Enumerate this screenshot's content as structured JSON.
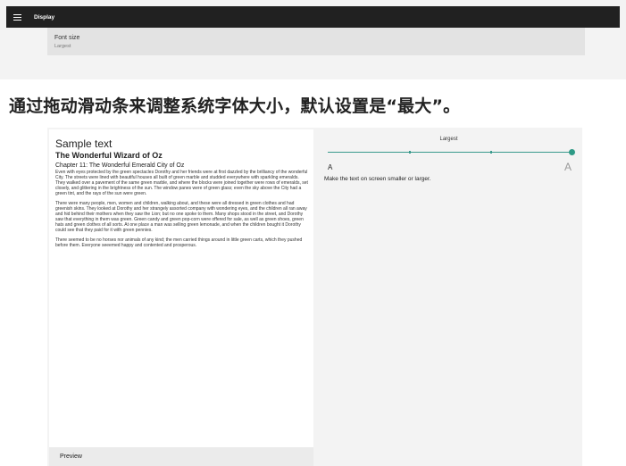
{
  "top": {
    "app_title": "Display",
    "menu_icon": "hamburger-menu-icon",
    "setting": {
      "title": "Font size",
      "value": "Largest"
    }
  },
  "caption": "通过拖动滑动条来调整系统字体大小，默认设置是“最大”。",
  "preview": {
    "heading": "Sample text",
    "book_title": "The Wonderful Wizard of Oz",
    "chapter": "Chapter 11: The Wonderful Emerald City of Oz",
    "paragraphs": [
      "Even with eyes protected by the green spectacles Dorothy and her friends were at first dazzled by the brilliancy of the wonderful City. The streets were lined with beautiful houses all built of green marble and studded everywhere with sparkling emeralds. They walked over a pavement of the same green marble, and where the blocks were joined together were rows of emeralds, set closely, and glittering in the brightness of the sun. The window panes were of green glass; even the sky above the City had a green tint, and the rays of the sun were green.",
      "There were many people, men, women and children, walking about, and these were all dressed in green clothes and had greenish skins. They looked at Dorothy and her strangely assorted company with wondering eyes, and the children all ran away and hid behind their mothers when they saw the Lion; but no one spoke to them. Many shops stood in the street, and Dorothy saw that everything in them was green. Green candy and green pop-corn were offered for sale, as well as green shoes, green hats and green clothes of all sorts. At one place a man was selling green lemonade, and when the children bought it Dorothy could see that they paid for it with green pennies.",
      "There seemed to be no horses nor animals of any kind; the men carried things around in little green carts, which they pushed before them. Everyone seeemed happy and contented and prosperous."
    ],
    "footer_label": "Preview"
  },
  "slider": {
    "current_label": "Largest",
    "small_a": "A",
    "large_a": "A",
    "description": "Make the text on screen smaller or larger.",
    "position": 1.0,
    "steps": 4,
    "accent_color": "#2e9a86"
  }
}
